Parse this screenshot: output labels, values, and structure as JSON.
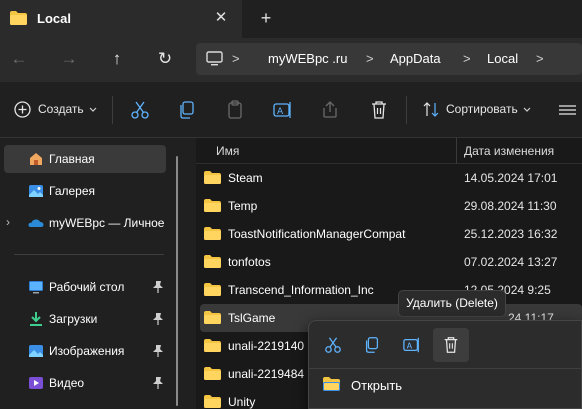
{
  "window": {
    "tab_title": "Local",
    "tab_close": "✕",
    "new_tab": "+"
  },
  "nav": {
    "back": "←",
    "forward": "→",
    "up": "↑",
    "refresh": "↻",
    "breadcrumbs": [
      "myWEBpc .ru",
      "AppData",
      "Local"
    ],
    "separator": ">"
  },
  "commands": {
    "create_label": "Создать",
    "sort_label": "Сортировать"
  },
  "sidebar": {
    "items": [
      {
        "label": "Главная",
        "icon": "home-icon",
        "selected": true
      },
      {
        "label": "Галерея",
        "icon": "gallery-icon"
      },
      {
        "label": "myWEBpc — Личное",
        "icon": "onedrive-icon"
      },
      {
        "label": "Рабочий стол",
        "icon": "desktop-icon",
        "pinned": true
      },
      {
        "label": "Загрузки",
        "icon": "downloads-icon",
        "pinned": true
      },
      {
        "label": "Изображения",
        "icon": "pictures-icon",
        "pinned": true
      },
      {
        "label": "Видео",
        "icon": "videos-icon",
        "pinned": true
      }
    ],
    "expand_chevron": "›"
  },
  "files": {
    "columns": {
      "name": "Имя",
      "date": "Дата изменения"
    },
    "rows": [
      {
        "name": "Steam",
        "date": "14.05.2024 17:01"
      },
      {
        "name": "Temp",
        "date": "29.08.2024 11:30"
      },
      {
        "name": "ToastNotificationManagerCompat",
        "date": "25.12.2023 16:32"
      },
      {
        "name": "tonfotos",
        "date": "07.02.2024 13:27"
      },
      {
        "name": "Transcend_Information_Inc",
        "date": "12.05.2024 9:25"
      },
      {
        "name": "TslGame",
        "date": "24 11:17",
        "selected": true
      },
      {
        "name": "unali-2219140",
        "date": ""
      },
      {
        "name": "unali-2219484",
        "date": ""
      },
      {
        "name": "Unity",
        "date": ""
      }
    ]
  },
  "tooltip": {
    "text": "Удалить (Delete)"
  },
  "context_menu": {
    "open_label": "Открыть",
    "actions": [
      "cut-icon",
      "copy-icon",
      "rename-icon",
      "delete-icon"
    ]
  },
  "colors": {
    "folder": "#f4c542",
    "accent": "#4cc2ff",
    "onedrive": "#2b8ad8"
  }
}
